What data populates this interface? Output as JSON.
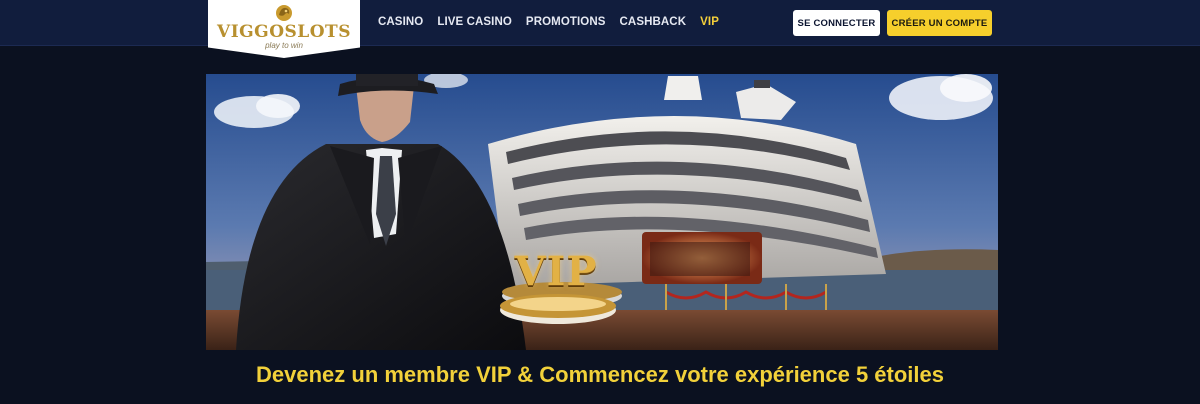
{
  "brand": {
    "name": "VIGGOSLOTS",
    "tagline": "play to win",
    "color": "#b8902f"
  },
  "nav": {
    "items": [
      {
        "label": "CASINO"
      },
      {
        "label": "LIVE CASINO"
      },
      {
        "label": "PROMOTIONS"
      },
      {
        "label": "CASHBACK"
      },
      {
        "label": "VIP",
        "active": true
      }
    ],
    "active_color": "#f4cf3a"
  },
  "header_buttons": {
    "login": "SE CONNECTER",
    "register": "CRÉER UN COMPTE"
  },
  "hero": {
    "badge_text": "VIP"
  },
  "headline": "Devenez un membre VIP & Commencez votre expérience 5 étoiles",
  "colors": {
    "background": "#0b1120",
    "header": "#111d3d",
    "accent_yellow": "#f6cf2c"
  },
  "icons": {
    "logo_mark": "gold-lion-crest-icon"
  }
}
